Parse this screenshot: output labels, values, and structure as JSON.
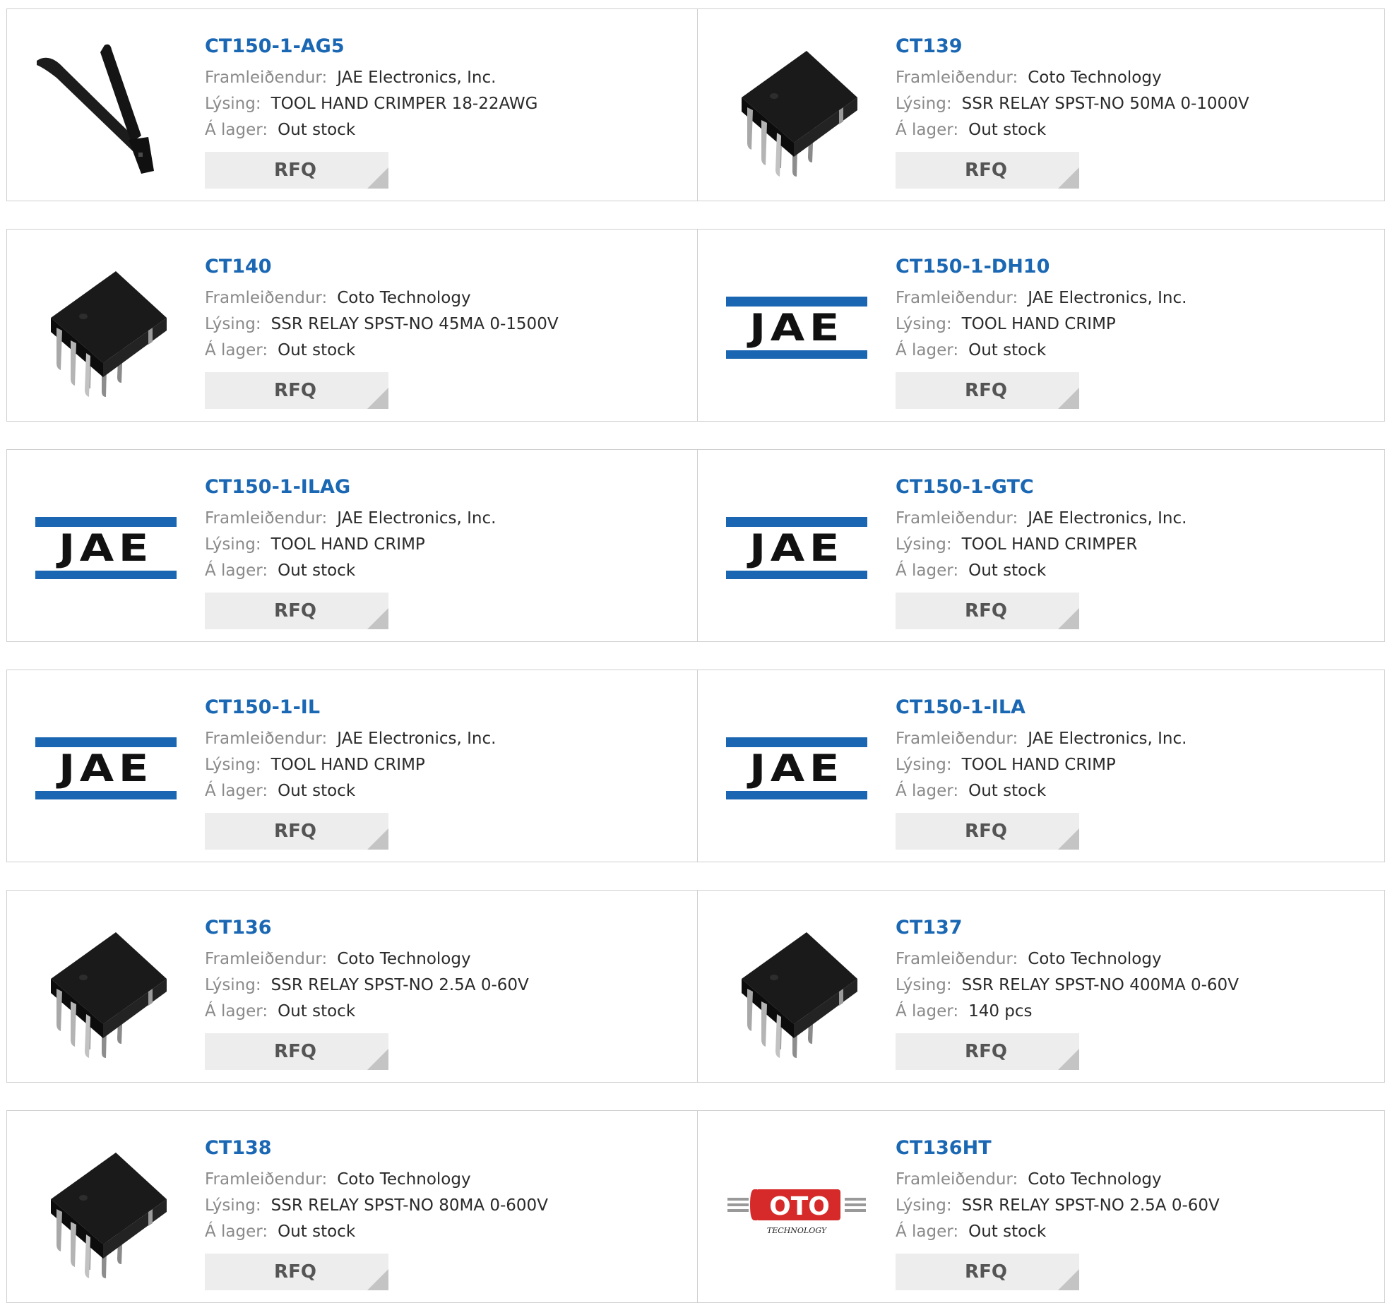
{
  "labels": {
    "manufacturer": "Framleiðendur:",
    "description": "Lýsing:",
    "stock": "Á lager:",
    "rfq": "RFQ"
  },
  "brand_logos": {
    "jae": "JAE",
    "coto_main": "OTO",
    "coto_sub": "TECHNOLOGY"
  },
  "colors": {
    "link": "#1a67b3",
    "jae_blue": "#1a66b2",
    "coto_red": "#d62a2a"
  },
  "products": [
    {
      "part": "CT150-1-AG5",
      "manufacturer": "JAE Electronics, Inc.",
      "description": "TOOL HAND CRIMPER 18-22AWG",
      "stock": "Out stock",
      "image": "crimper-tool"
    },
    {
      "part": "CT139",
      "manufacturer": "Coto Technology",
      "description": "SSR RELAY SPST-NO 50MA 0-1000V",
      "stock": "Out stock",
      "image": "dip-chip"
    },
    {
      "part": "CT140",
      "manufacturer": "Coto Technology",
      "description": "SSR RELAY SPST-NO 45MA 0-1500V",
      "stock": "Out stock",
      "image": "dip-chip"
    },
    {
      "part": "CT150-1-DH10",
      "manufacturer": "JAE Electronics, Inc.",
      "description": "TOOL HAND CRIMP",
      "stock": "Out stock",
      "image": "jae-logo"
    },
    {
      "part": "CT150-1-ILAG",
      "manufacturer": "JAE Electronics, Inc.",
      "description": "TOOL HAND CRIMP",
      "stock": "Out stock",
      "image": "jae-logo"
    },
    {
      "part": "CT150-1-GTC",
      "manufacturer": "JAE Electronics, Inc.",
      "description": "TOOL HAND CRIMPER",
      "stock": "Out stock",
      "image": "jae-logo"
    },
    {
      "part": "CT150-1-IL",
      "manufacturer": "JAE Electronics, Inc.",
      "description": "TOOL HAND CRIMP",
      "stock": "Out stock",
      "image": "jae-logo"
    },
    {
      "part": "CT150-1-ILA",
      "manufacturer": "JAE Electronics, Inc.",
      "description": "TOOL HAND CRIMP",
      "stock": "Out stock",
      "image": "jae-logo"
    },
    {
      "part": "CT136",
      "manufacturer": "Coto Technology",
      "description": "SSR RELAY SPST-NO 2.5A 0-60V",
      "stock": "Out stock",
      "image": "dip-chip"
    },
    {
      "part": "CT137",
      "manufacturer": "Coto Technology",
      "description": "SSR RELAY SPST-NO 400MA 0-60V",
      "stock": "140 pcs",
      "image": "dip-chip"
    },
    {
      "part": "CT138",
      "manufacturer": "Coto Technology",
      "description": "SSR RELAY SPST-NO 80MA 0-600V",
      "stock": "Out stock",
      "image": "dip-chip"
    },
    {
      "part": "CT136HT",
      "manufacturer": "Coto Technology",
      "description": "SSR RELAY SPST-NO 2.5A 0-60V",
      "stock": "Out stock",
      "image": "coto-logo"
    }
  ]
}
